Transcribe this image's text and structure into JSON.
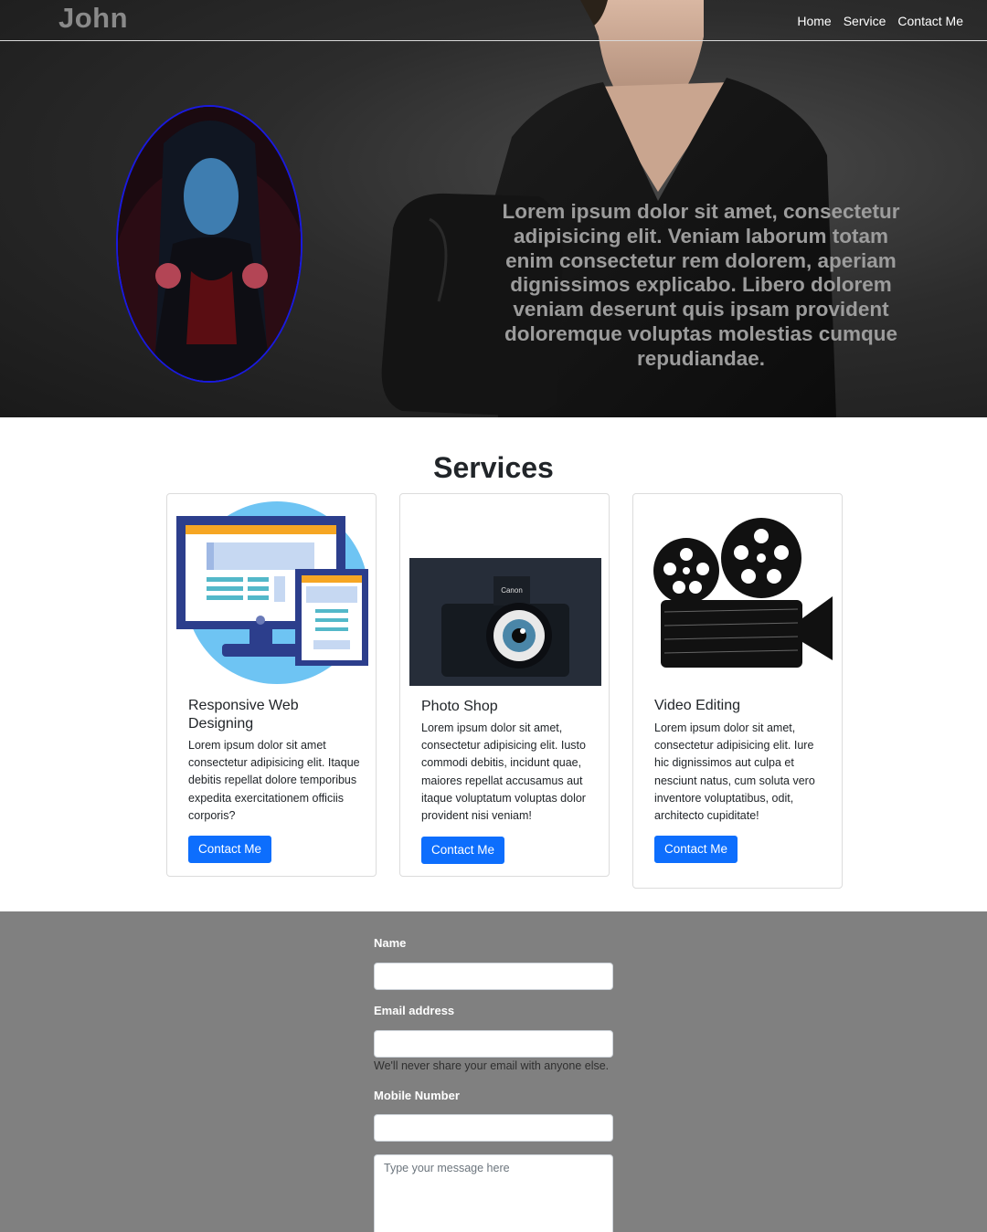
{
  "navbar": {
    "brand": "John",
    "links": [
      "Home",
      "Service",
      "Contact Me"
    ]
  },
  "hero": {
    "text": "Lorem ipsum dolor sit amet, consectetur adipisicing elit. Veniam laborum totam enim consectetur rem dolorem, aperiam dignissimos explicabo. Libero dolorem veniam deserunt quis ipsam provident doloremque voluptas molestias cumque repudiandae."
  },
  "services": {
    "title": "Services",
    "cards": [
      {
        "title": "Responsive Web Designing",
        "text": "Lorem ipsum dolor sit amet consectetur adipisicing elit. Itaque debitis repellat dolore temporibus expedita exercitationem officiis corporis?",
        "button": "Contact Me",
        "icon": "responsive-devices-icon"
      },
      {
        "title": "Photo Shop",
        "text": "Lorem ipsum dolor sit amet, consectetur adipisicing elit. Iusto commodi debitis, incidunt quae, maiores repellat accusamus aut itaque voluptatum voluptas dolor provident nisi veniam!",
        "button": "Contact Me",
        "icon": "camera-eye-image"
      },
      {
        "title": "Video Editing",
        "text": "Lorem ipsum dolor sit amet, consectetur adipisicing elit. Iure hic dignissimos aut culpa et nesciunt natus, cum soluta vero inventore voluptatibus, odit, architecto cupiditate!",
        "button": "Contact Me",
        "icon": "film-camera-icon"
      }
    ]
  },
  "contact_form": {
    "name_label": "Name",
    "email_label": "Email address",
    "email_help": "We'll never share your email with anyone else.",
    "mobile_label": "Mobile Number",
    "message_placeholder": "Type your message here"
  },
  "colors": {
    "primary_button": "#0d6efd",
    "form_background": "#808080",
    "avatar_border": "#1a1adf"
  }
}
